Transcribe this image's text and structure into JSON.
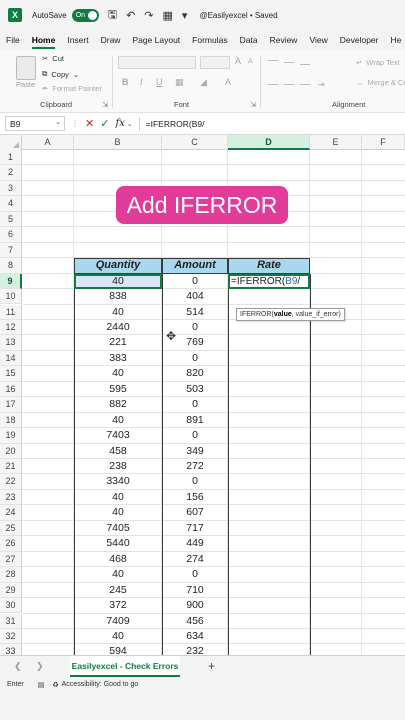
{
  "titlebar": {
    "logo": "X",
    "autosave_label": "AutoSave",
    "toggle_label": "On",
    "doc_title": "@Easilyexcel • Saved",
    "icons": [
      "save-icon",
      "undo-icon",
      "redo-icon",
      "grid-icon",
      "customize-icon"
    ]
  },
  "tabs": [
    "File",
    "Home",
    "Insert",
    "Draw",
    "Page Layout",
    "Formulas",
    "Data",
    "Review",
    "View",
    "Developer",
    "He"
  ],
  "active_tab": "Home",
  "ribbon": {
    "paste": "Paste",
    "cut": "Cut",
    "copy": "Copy",
    "format_painter": "Format Painter",
    "clipboard_label": "Clipboard",
    "font_label": "Font",
    "bold": "B",
    "italic": "I",
    "underline": "U",
    "font_grow": "A",
    "font_shrink": "A",
    "wrap_text": "Wrap Text",
    "merge_center": "Merge & Ce",
    "alignment_label": "Alignment"
  },
  "formula_bar": {
    "name_box": "B9",
    "fx": "fx",
    "formula": "=IFERROR(B9/"
  },
  "columns": [
    "A",
    "B",
    "C",
    "D",
    "E",
    "F"
  ],
  "active_column": "D",
  "rows": [
    "1",
    "2",
    "3",
    "4",
    "5",
    "6",
    "7",
    "8",
    "9",
    "10",
    "11",
    "12",
    "13",
    "14",
    "15",
    "16",
    "17",
    "18",
    "19",
    "20",
    "21",
    "22",
    "23",
    "24",
    "25",
    "26",
    "27",
    "28",
    "29",
    "30",
    "31",
    "32",
    "33"
  ],
  "active_row": "9",
  "overlay_title": "Add IFERROR",
  "table": {
    "headers": [
      "Quantity",
      "Amount",
      "Rate"
    ],
    "quantity": [
      "40",
      "838",
      "40",
      "2440",
      "221",
      "383",
      "40",
      "595",
      "882",
      "40",
      "7403",
      "458",
      "238",
      "3340",
      "40",
      "40",
      "7405",
      "5440",
      "468",
      "40",
      "245",
      "372",
      "7409",
      "40",
      "594"
    ],
    "amount": [
      "0",
      "404",
      "514",
      "0",
      "769",
      "0",
      "820",
      "503",
      "0",
      "891",
      "0",
      "349",
      "272",
      "0",
      "156",
      "607",
      "717",
      "449",
      "274",
      "0",
      "710",
      "900",
      "456",
      "634",
      "232"
    ]
  },
  "edit_cell": {
    "prefix": "=IFERROR(",
    "ref": "B9",
    "suffix": "/"
  },
  "tooltip": {
    "func": "IFERROR(",
    "arg1": "value",
    "rest": ", value_if_error)"
  },
  "sheet_tab": "Easilyexcel - Check Errors",
  "status": {
    "mode": "Enter",
    "accessibility": "Accessibility: Good to go"
  },
  "colors": {
    "excel_green": "#107c41",
    "header_fill": "#a8d8ee",
    "pill_pink": "#e23c9b"
  }
}
